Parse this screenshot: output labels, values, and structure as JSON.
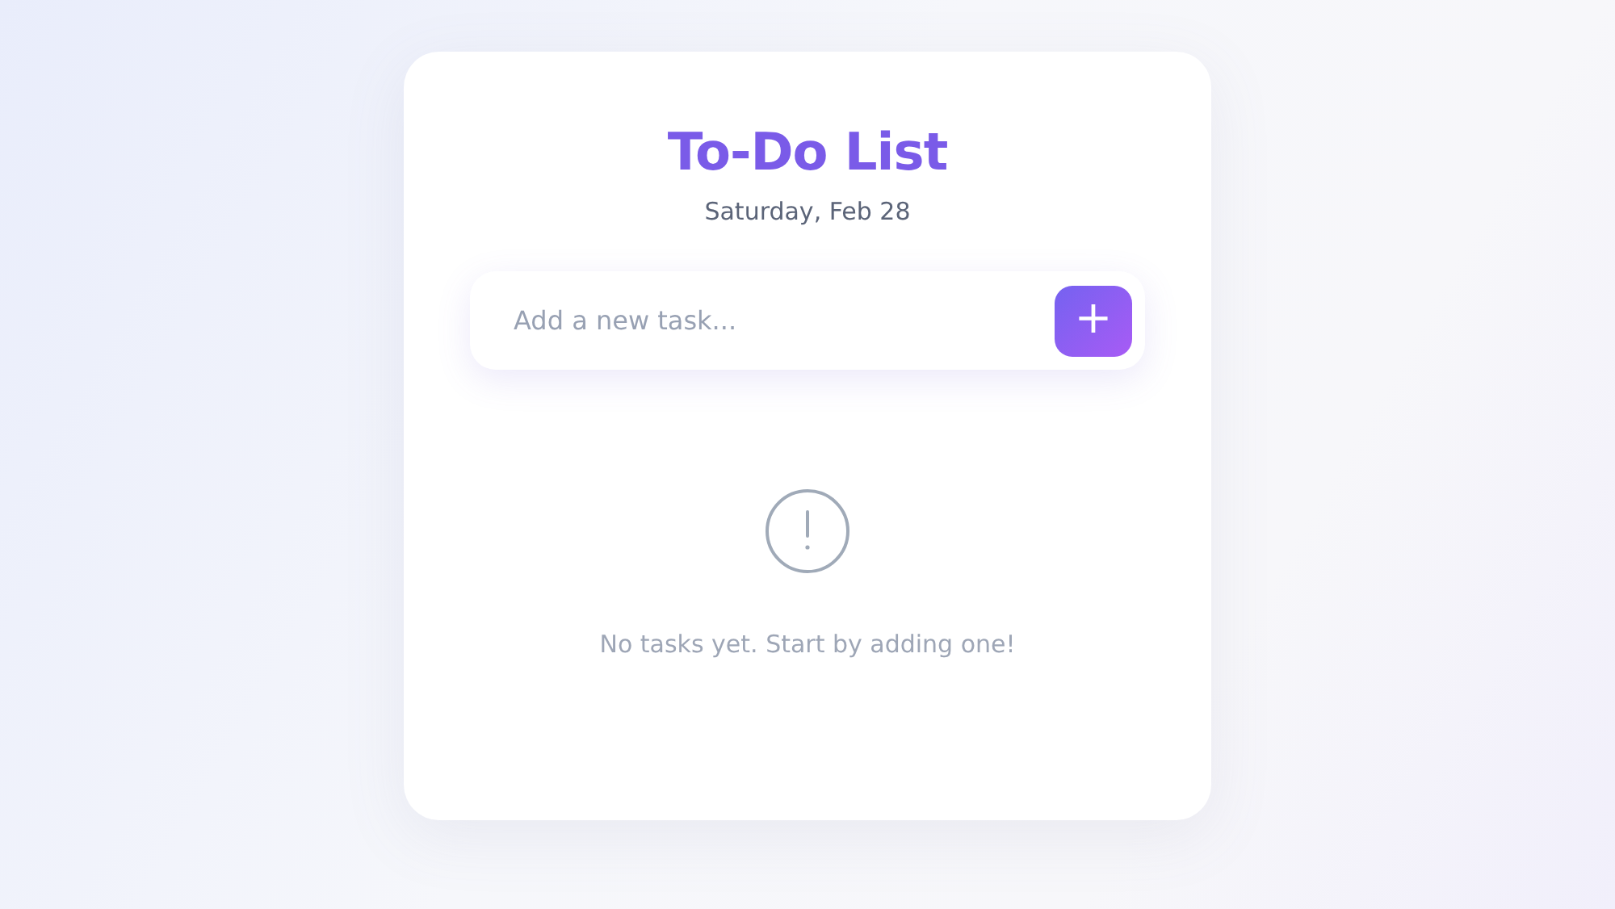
{
  "title": "To-Do List",
  "date": "Saturday, Feb 28",
  "new_task": {
    "placeholder": "Add a new task...",
    "add_button": "+"
  },
  "empty_state": {
    "message": "No tasks yet. Start by adding one!"
  }
}
